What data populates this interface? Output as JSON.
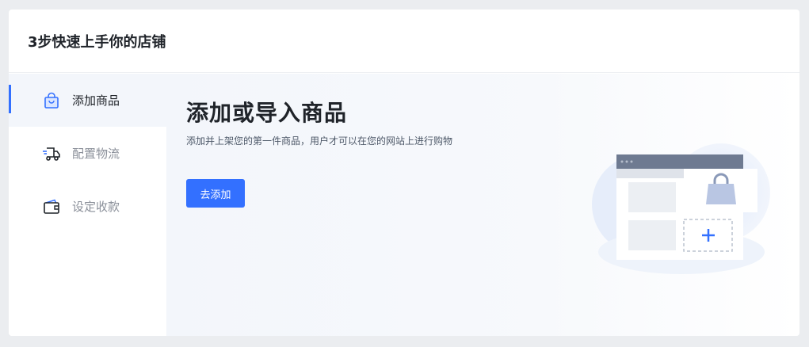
{
  "header": {
    "title": "3步快速上手你的店铺"
  },
  "sidebar": {
    "items": [
      {
        "label": "添加商品",
        "icon": "shopping-bag-icon",
        "active": true
      },
      {
        "label": "配置物流",
        "icon": "delivery-truck-icon",
        "active": false
      },
      {
        "label": "设定收款",
        "icon": "wallet-icon",
        "active": false
      }
    ]
  },
  "main": {
    "title": "添加或导入商品",
    "description": "添加并上架您的第一件商品，用户才可以在您的网站上进行购物",
    "button_label": "去添加"
  },
  "colors": {
    "accent": "#3370ff",
    "page_background": "#ebedf0",
    "panel_background": "#f3f6fb"
  }
}
